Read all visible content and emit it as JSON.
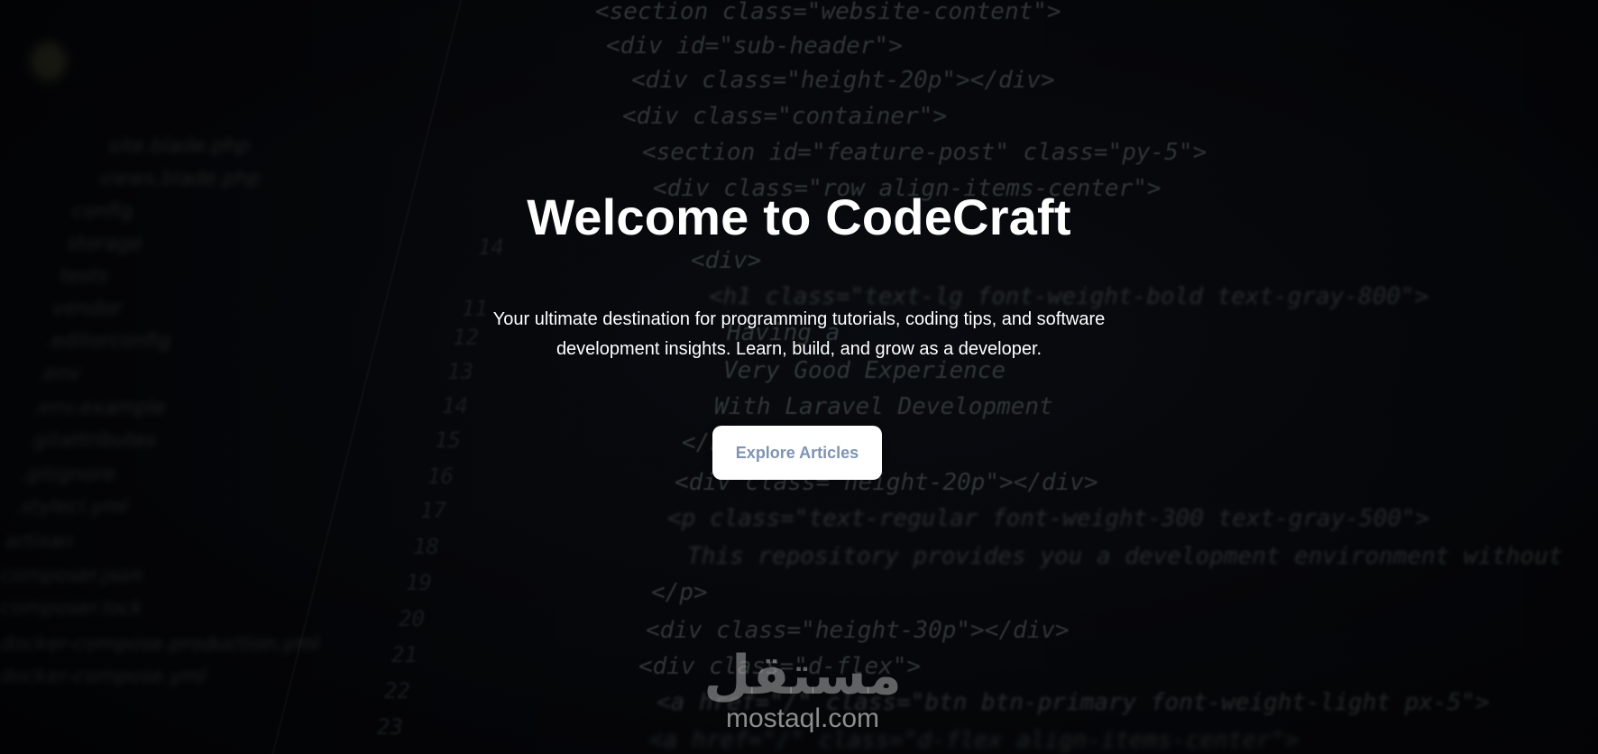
{
  "hero": {
    "title": "Welcome to CodeCraft",
    "subtitle": "Your ultimate destination for programming tutorials, coding tips, and software development insights. Learn, build, and grow as a developer.",
    "cta_label": "Explore Articles"
  },
  "background_code": {
    "lines": [
      "<section class=\"website-content\">",
      "<div id=\"sub-header\">",
      "<div class=\"height-20p\"></div>",
      "<div class=\"container\">",
      "<section id=\"feature-post\" class=\"py-5\">",
      "<div class=\"row align-items-center\">",
      "<div>",
      "<h1 class=\"text-lg font-weight-bold text-gray-800\">",
      "Having a",
      "Very Good Experience",
      "With Laravel Development",
      "</h1>",
      "<div class=\"height-20p\"></div>",
      "<p class=\"text-regular font-weight-300 text-gray-500\">",
      "This repository provides you a development environment without",
      "</p>",
      "<div class=\"height-30p\"></div>",
      "<div class=\"d-flex\">",
      "<a href=\"/\" class=\"btn btn-primary font-weight-light px-5\">",
      "<a href=\"/\" class=\"d-flex align-items-center\">"
    ],
    "line_numbers": [
      "14",
      "11",
      "12",
      "13",
      "14",
      "15",
      "16",
      "17",
      "18",
      "19",
      "20",
      "21",
      "22",
      "23"
    ],
    "tree_items": [
      "site.blade.php",
      "views.blade.php",
      "config",
      "storage",
      "tests",
      "vendor",
      ".editorconfig",
      ".env",
      ".env.example",
      ".gitattributes",
      ".gitignore",
      ".styleci.yml",
      "artisan",
      "composer.json",
      "composer.lock",
      "docker-compose.production.yml",
      "docker-compose.yml"
    ]
  },
  "watermark": {
    "arabic": "مستقل",
    "latin": "mostaql.com"
  }
}
